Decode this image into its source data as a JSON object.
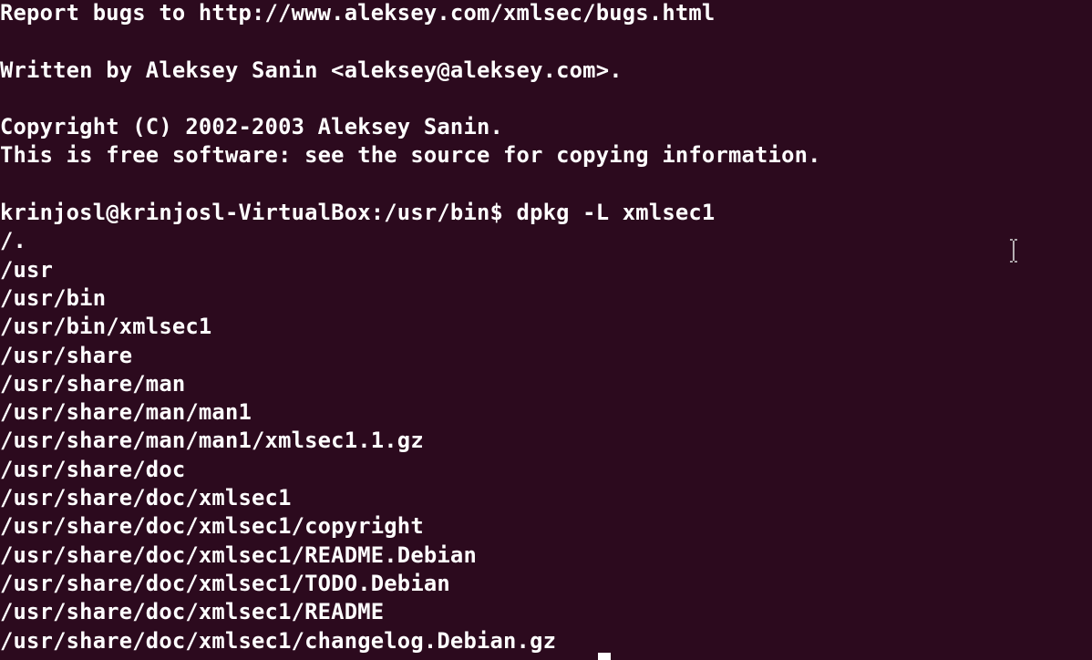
{
  "terminal": {
    "lines": [
      "Report bugs to http://www.aleksey.com/xmlsec/bugs.html",
      "",
      "Written by Aleksey Sanin <aleksey@aleksey.com>.",
      "",
      "Copyright (C) 2002-2003 Aleksey Sanin.",
      "This is free software: see the source for copying information.",
      "",
      "krinjosl@krinjosl-VirtualBox:/usr/bin$ dpkg -L xmlsec1",
      "/.",
      "/usr",
      "/usr/bin",
      "/usr/bin/xmlsec1",
      "/usr/share",
      "/usr/share/man",
      "/usr/share/man/man1",
      "/usr/share/man/man1/xmlsec1.1.gz",
      "/usr/share/doc",
      "/usr/share/doc/xmlsec1",
      "/usr/share/doc/xmlsec1/copyright",
      "/usr/share/doc/xmlsec1/README.Debian",
      "/usr/share/doc/xmlsec1/TODO.Debian",
      "/usr/share/doc/xmlsec1/README",
      "/usr/share/doc/xmlsec1/changelog.Debian.gz"
    ],
    "colors": {
      "background": "#2c0a1e",
      "foreground": "#ffffff"
    },
    "pointer_icon": "text-ibeam-cursor-icon"
  }
}
